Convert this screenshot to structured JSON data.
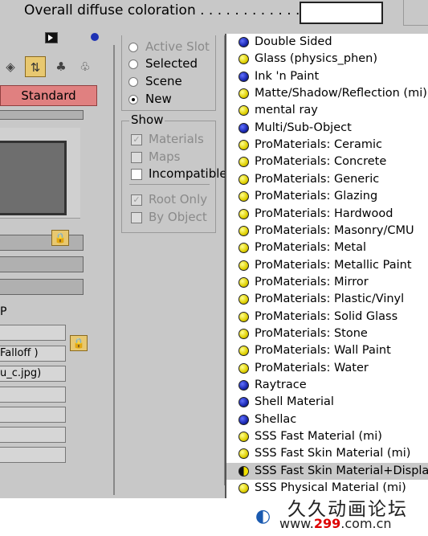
{
  "topbar": {
    "label": "Overall diffuse coloration . . . . . . . . . . . ."
  },
  "left": {
    "standard_button": "Standard",
    "p_label": "P",
    "fields": [
      "",
      "Falloff )",
      "u_c.jpg)",
      "",
      "",
      "",
      ""
    ]
  },
  "browse_from": {
    "options": [
      {
        "label": "Active Slot",
        "disabled": true,
        "selected": false
      },
      {
        "label": "Selected",
        "disabled": false,
        "selected": false
      },
      {
        "label": "Scene",
        "disabled": false,
        "selected": false
      },
      {
        "label": "New",
        "disabled": false,
        "selected": true
      }
    ]
  },
  "show": {
    "title": "Show",
    "options": [
      {
        "label": "Materials",
        "disabled": true,
        "checked": true
      },
      {
        "label": "Maps",
        "disabled": true,
        "checked": false
      },
      {
        "label": "Incompatible",
        "disabled": false,
        "checked": false
      },
      {
        "label": "Root Only",
        "disabled": true,
        "checked": true
      },
      {
        "label": "By Object",
        "disabled": true,
        "checked": false
      }
    ]
  },
  "materials": [
    {
      "label": "Double Sided",
      "icon": "blue-sphere-icon"
    },
    {
      "label": "Glass (physics_phen)",
      "icon": "yellow-sphere-icon"
    },
    {
      "label": "Ink 'n Paint",
      "icon": "blue-sphere-icon"
    },
    {
      "label": "Matte/Shadow/Reflection (mi)",
      "icon": "yellow-sphere-icon"
    },
    {
      "label": "mental ray",
      "icon": "yellow-sphere-icon"
    },
    {
      "label": "Multi/Sub-Object",
      "icon": "blue-sphere-icon"
    },
    {
      "label": "ProMaterials: Ceramic",
      "icon": "yellow-sphere-icon"
    },
    {
      "label": "ProMaterials: Concrete",
      "icon": "yellow-sphere-icon"
    },
    {
      "label": "ProMaterials: Generic",
      "icon": "yellow-sphere-icon"
    },
    {
      "label": "ProMaterials: Glazing",
      "icon": "yellow-sphere-icon"
    },
    {
      "label": "ProMaterials: Hardwood",
      "icon": "yellow-sphere-icon"
    },
    {
      "label": "ProMaterials: Masonry/CMU",
      "icon": "yellow-sphere-icon"
    },
    {
      "label": "ProMaterials: Metal",
      "icon": "yellow-sphere-icon"
    },
    {
      "label": "ProMaterials: Metallic Paint",
      "icon": "yellow-sphere-icon"
    },
    {
      "label": "ProMaterials: Mirror",
      "icon": "yellow-sphere-icon"
    },
    {
      "label": "ProMaterials: Plastic/Vinyl",
      "icon": "yellow-sphere-icon"
    },
    {
      "label": "ProMaterials: Solid Glass",
      "icon": "yellow-sphere-icon"
    },
    {
      "label": "ProMaterials: Stone",
      "icon": "yellow-sphere-icon"
    },
    {
      "label": "ProMaterials: Wall Paint",
      "icon": "yellow-sphere-icon"
    },
    {
      "label": "ProMaterials: Water",
      "icon": "yellow-sphere-icon"
    },
    {
      "label": "Raytrace",
      "icon": "blue-sphere-icon"
    },
    {
      "label": "Shell Material",
      "icon": "blue-sphere-icon"
    },
    {
      "label": "Shellac",
      "icon": "blue-sphere-icon"
    },
    {
      "label": "SSS Fast Material (mi)",
      "icon": "yellow-sphere-icon"
    },
    {
      "label": "SSS Fast Skin Material (mi)",
      "icon": "yellow-sphere-icon"
    },
    {
      "label": "SSS Fast Skin Material+Displace (m",
      "icon": "half-sphere-icon",
      "selected": true
    },
    {
      "label": "SSS Physical Material (mi)",
      "icon": "yellow-sphere-icon"
    }
  ],
  "watermark": {
    "title": "久久动画论坛",
    "url_prefix": "www.",
    "url_num": "299",
    "url_suffix": ".com.cn"
  }
}
